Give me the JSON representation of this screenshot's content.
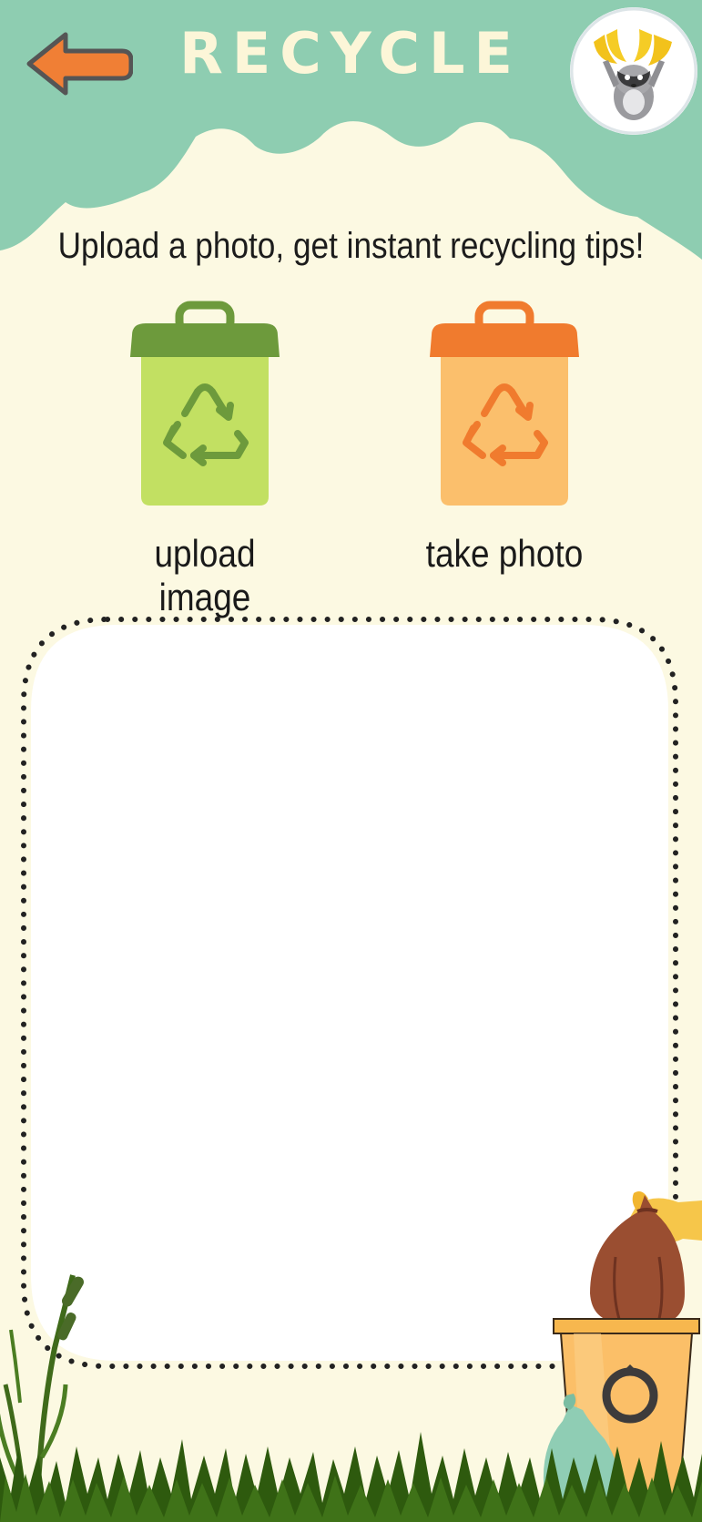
{
  "header": {
    "title": "RECYCLE",
    "back_icon": "arrow-left-icon",
    "avatar_icon": "raccoon-with-bananas-avatar"
  },
  "tagline": "Upload a photo, get instant recycling tips!",
  "actions": [
    {
      "label": "upload image",
      "icon": "recycle-bin-icon",
      "color": "#c2e062",
      "lid_color": "#6d9a3c"
    },
    {
      "label": "take photo",
      "icon": "recycle-bin-icon",
      "color": "#fbbf6c",
      "lid_color": "#f07b2e"
    }
  ],
  "colors": {
    "header": "#8ecdb1",
    "background": "#fcf9e2",
    "accent_orange": "#f07f35",
    "title_text": "#fcf6d8"
  },
  "decor": {
    "icons": [
      "grass-icon",
      "cattail-plant-icon",
      "trash-bag-icon",
      "orange-recycle-bin-icon",
      "glove-hand-icon"
    ]
  }
}
